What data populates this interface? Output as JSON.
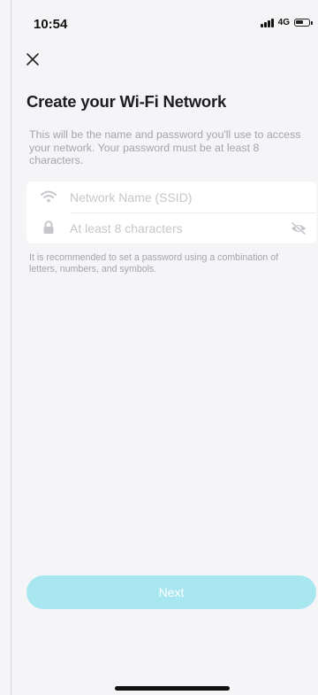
{
  "status_bar": {
    "time": "10:54",
    "network": "4G"
  },
  "header": {
    "close_icon": "close-icon"
  },
  "content": {
    "title": "Create your Wi-Fi Network",
    "description": "This will be the name and password you'll use to access your network. Your password must be at least 8 characters.",
    "hint": "It is recommended to set a password using a combination of letters, numbers, and symbols."
  },
  "form": {
    "ssid": {
      "icon": "wifi-icon",
      "value": "",
      "placeholder": "Network Name (SSID)"
    },
    "password": {
      "icon": "lock-icon",
      "value": "",
      "placeholder": "At least 8 characters",
      "toggle_icon": "eye-slash-icon"
    }
  },
  "footer": {
    "next_label": "Next",
    "next_color": "#a8e6f0"
  },
  "colors": {
    "background": "#f5f5f7",
    "card": "#ffffff",
    "title": "#1d1d1f",
    "muted_text": "#a4a4aa",
    "placeholder": "#c6c6cb"
  }
}
